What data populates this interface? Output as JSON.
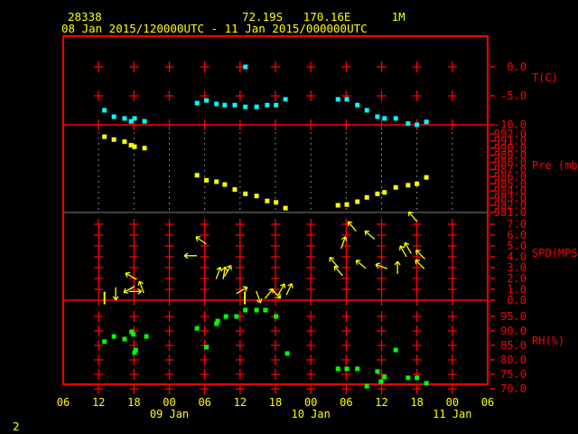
{
  "header": {
    "station": "28338",
    "location": "72.19S   170.16E      1M",
    "period": "08 Jan 2015/120000UTC - 11 Jan 2015/000000UTC"
  },
  "page_number": "2",
  "colors": {
    "frame": "#ff0000",
    "text": "#ffff00",
    "temperature": "#00ffff",
    "pressure": "#ffff00",
    "wind": "#ffff00",
    "rh": "#00ff00",
    "grid": "#808080"
  },
  "chart_data": [
    {
      "type": "scatter",
      "title": "T(C)",
      "ylabel": "T(C)",
      "ylim": [
        -10,
        5.3
      ],
      "tick_labels": [
        "0.0",
        "-5.0",
        "-10.0"
      ],
      "ticks": [
        0,
        -5,
        -10
      ],
      "x_units": "hours since 08 Jan 06Z",
      "points": [
        [
          7.0,
          -7.5
        ],
        [
          8.6,
          -8.6
        ],
        [
          10.4,
          -8.9
        ],
        [
          11.5,
          -9.4
        ],
        [
          12.1,
          -8.9
        ],
        [
          13.8,
          -9.4
        ],
        [
          22.7,
          -6.25
        ],
        [
          24.3,
          -5.8
        ],
        [
          26.0,
          -6.4
        ],
        [
          27.4,
          -6.6
        ],
        [
          29.1,
          -6.6
        ],
        [
          30.9,
          -6.9
        ],
        [
          32.8,
          -6.9
        ],
        [
          34.6,
          -6.6
        ],
        [
          36.1,
          -6.6
        ],
        [
          37.7,
          -5.6
        ],
        [
          30.9,
          0.0
        ],
        [
          46.6,
          -5.6
        ],
        [
          48.1,
          -5.6
        ],
        [
          49.9,
          -6.6
        ],
        [
          51.5,
          -7.5
        ],
        [
          53.3,
          -8.6
        ],
        [
          54.5,
          -8.9
        ],
        [
          56.4,
          -8.9
        ],
        [
          58.5,
          -9.8
        ],
        [
          60.0,
          -10.0
        ],
        [
          61.6,
          -9.5
        ]
      ]
    },
    {
      "type": "scatter",
      "title": "Pre (mb)",
      "ylabel": "Pre (mb)",
      "ylim": [
        981,
        992
      ],
      "tick_labels": [
        "992.0",
        "991.0",
        "990.0",
        "989.0",
        "988.0",
        "987.0",
        "986.0",
        "985.0",
        "984.0",
        "983.0",
        "982.0",
        "981.0"
      ],
      "ticks": [
        992,
        991,
        990,
        989,
        988,
        987,
        986,
        985,
        984,
        983,
        982,
        981
      ],
      "points": [
        [
          7.0,
          991.6
        ],
        [
          8.6,
          991.2
        ],
        [
          10.4,
          990.9
        ],
        [
          11.5,
          990.4
        ],
        [
          12.1,
          990.2
        ],
        [
          13.8,
          990.0
        ],
        [
          22.7,
          986.2
        ],
        [
          24.3,
          985.5
        ],
        [
          26.0,
          985.3
        ],
        [
          27.4,
          984.9
        ],
        [
          29.1,
          984.2
        ],
        [
          30.9,
          983.6
        ],
        [
          32.8,
          983.3
        ],
        [
          34.6,
          982.6
        ],
        [
          36.1,
          982.4
        ],
        [
          37.7,
          981.6
        ],
        [
          46.6,
          982.0
        ],
        [
          48.1,
          982.1
        ],
        [
          49.9,
          982.5
        ],
        [
          51.5,
          983.1
        ],
        [
          53.3,
          983.6
        ],
        [
          54.5,
          983.8
        ],
        [
          56.4,
          984.5
        ],
        [
          58.5,
          984.8
        ],
        [
          60.0,
          985.0
        ],
        [
          61.6,
          985.9
        ]
      ]
    },
    {
      "type": "scatter",
      "title": "SPD(MPS)",
      "ylabel": "SPD(MPS)",
      "ylim": [
        0,
        7
      ],
      "tick_labels": [
        "7.0",
        "6.0",
        "5.0",
        "4.0",
        "3.0",
        "2.0",
        "1.0",
        "0.0"
      ],
      "ticks": [
        7,
        6,
        5,
        4,
        3,
        2,
        1,
        0
      ],
      "point_format": "[hour, speed, direction_deg]",
      "points": [
        [
          7.0,
          0.2,
          0
        ],
        [
          8.9,
          0.6,
          180
        ],
        [
          11.2,
          1.0,
          240
        ],
        [
          11.5,
          2.2,
          300
        ],
        [
          12.2,
          0.8,
          90
        ],
        [
          13.3,
          1.2,
          340
        ],
        [
          23.4,
          5.5,
          305
        ],
        [
          21.6,
          4.1,
          270
        ],
        [
          26.3,
          2.5,
          20
        ],
        [
          27.3,
          2.5,
          10
        ],
        [
          27.9,
          2.7,
          30
        ],
        [
          30.3,
          0.9,
          60
        ],
        [
          30.8,
          0.2,
          0
        ],
        [
          33.1,
          0.3,
          160
        ],
        [
          34.9,
          0.6,
          40
        ],
        [
          36.1,
          0.6,
          135
        ],
        [
          37.0,
          1.0,
          30
        ],
        [
          38.3,
          1.0,
          25
        ],
        [
          59.3,
          7.7,
          320
        ],
        [
          49.0,
          6.8,
          320
        ],
        [
          47.5,
          5.3,
          20
        ],
        [
          52.0,
          6.0,
          310
        ],
        [
          46.7,
          2.7,
          320
        ],
        [
          45.9,
          3.5,
          320
        ],
        [
          50.5,
          3.3,
          310
        ],
        [
          54.0,
          3.1,
          290
        ],
        [
          56.7,
          3.0,
          0
        ],
        [
          57.7,
          4.5,
          330
        ],
        [
          58.5,
          4.8,
          330
        ],
        [
          60.5,
          3.3,
          315
        ],
        [
          60.6,
          4.2,
          315
        ]
      ]
    },
    {
      "type": "scatter",
      "title": "RH(%)",
      "ylabel": "RH(%)",
      "ylim": [
        70,
        95
      ],
      "tick_labels": [
        "95.0",
        "90.0",
        "85.0",
        "80.0",
        "75.0",
        "70.0"
      ],
      "ticks": [
        95,
        90,
        85,
        80,
        75,
        70
      ],
      "points": [
        [
          7.0,
          86.3
        ],
        [
          8.6,
          88.1
        ],
        [
          10.4,
          87.2
        ],
        [
          11.6,
          89.7
        ],
        [
          11.9,
          88.8
        ],
        [
          12.1,
          82.5
        ],
        [
          12.3,
          83.4
        ],
        [
          14.1,
          88.1
        ],
        [
          22.7,
          90.9
        ],
        [
          24.3,
          84.4
        ],
        [
          26.0,
          92.5
        ],
        [
          26.2,
          93.4
        ],
        [
          27.6,
          95.0
        ],
        [
          29.4,
          95.0
        ],
        [
          30.9,
          97.2
        ],
        [
          32.8,
          97.2
        ],
        [
          34.3,
          97.2
        ],
        [
          36.1,
          95.0
        ],
        [
          38.0,
          82.2
        ],
        [
          46.6,
          76.9
        ],
        [
          48.1,
          76.9
        ],
        [
          49.9,
          76.9
        ],
        [
          51.5,
          70.9
        ],
        [
          53.3,
          76.0
        ],
        [
          53.9,
          72.5
        ],
        [
          54.5,
          74.1
        ],
        [
          56.4,
          83.4
        ],
        [
          58.5,
          73.8
        ],
        [
          60.0,
          73.8
        ],
        [
          61.6,
          71.9
        ]
      ]
    }
  ],
  "x_axis": {
    "hour_labels": [
      "06",
      "12",
      "18",
      "00",
      "06",
      "12",
      "18",
      "00",
      "06",
      "12",
      "18",
      "00",
      "06"
    ],
    "day_labels": [
      "09 Jan",
      "10 Jan",
      "11 Jan"
    ]
  }
}
